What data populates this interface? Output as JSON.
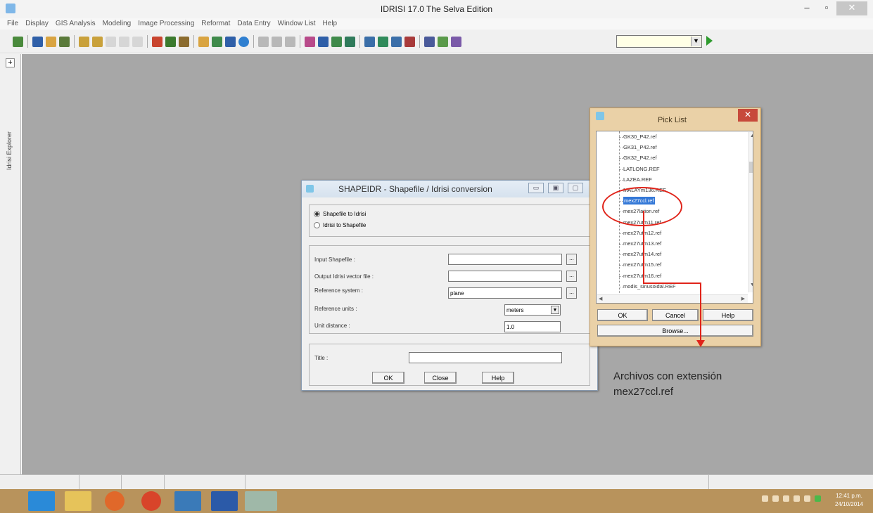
{
  "window": {
    "title": "IDRISI 17.0    The Selva Edition",
    "minimize": "‒",
    "maximize": "▫",
    "close": "✕"
  },
  "menu": [
    "File",
    "Display",
    "GIS Analysis",
    "Modeling",
    "Image Processing",
    "Reformat",
    "Data Entry",
    "Window List",
    "Help"
  ],
  "explorer": {
    "toggle": "+",
    "label": "Idrisi Explorer"
  },
  "shapeidr": {
    "title": "SHAPEIDR - Shapefile / Idrisi conversion",
    "radio_shape_to_idrisi": "Shapefile to Idrisi",
    "radio_idrisi_to_shape": "Idrisi to Shapefile",
    "input_label": "Input Shapefile :",
    "output_label": "Output Idrisi vector file :",
    "refsys_label": "Reference system :",
    "refsys_value": "plane",
    "refunits_label": "Reference units :",
    "refunits_value": "meters",
    "unitdist_label": "Unit distance :",
    "unitdist_value": "1.0",
    "title_label": "Title :",
    "ok": "OK",
    "close": "Close",
    "help": "Help"
  },
  "picklist": {
    "title": "Pick List",
    "items": [
      "GK30_P42.ref",
      "GK31_P42.ref",
      "GK32_P42.ref",
      "LATLONG.REF",
      "LAZEA.REF",
      "MALAYm136.REF",
      "mex27ccl.ref",
      "mex27lation.ref",
      "mex27utm11.ref",
      "mex27utm12.ref",
      "mex27utm13.ref",
      "mex27utm14.ref",
      "mex27utm15.ref",
      "mex27utm16.ref",
      "modis_sinusoidal.REF"
    ],
    "selected_index": 6,
    "ok": "OK",
    "cancel": "Cancel",
    "help": "Help",
    "browse": "Browse..."
  },
  "annotation": {
    "line1": "Archivos con extensión",
    "line2": "mex27ccl.ref"
  },
  "clock": {
    "time": "12:41 p.m.",
    "date": "24/10/2014"
  },
  "colors": {
    "workspace": "#a7a7a7",
    "taskbar": "#b8935c",
    "highlight": "#e0241a",
    "selection": "#3478d7"
  }
}
